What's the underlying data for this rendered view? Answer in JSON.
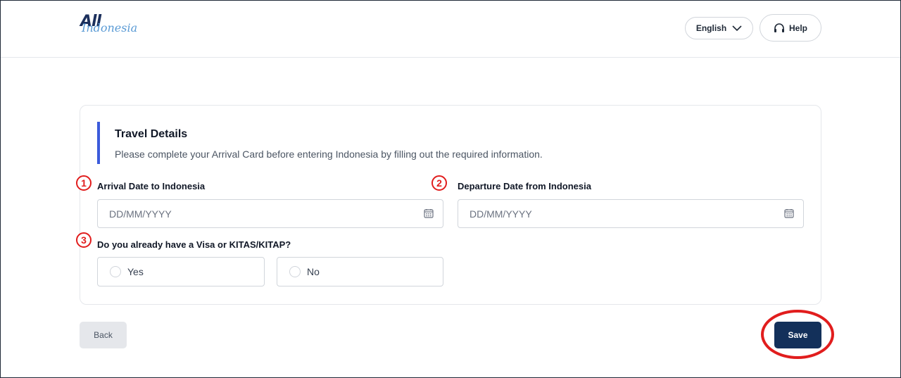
{
  "header": {
    "logo_main": "All",
    "logo_sub": "Indonesia",
    "language_label": "English",
    "help_label": "Help"
  },
  "form": {
    "title": "Travel Details",
    "subtitle": "Please complete your Arrival Card before entering Indonesia by filling out the required information.",
    "arrival": {
      "marker": "1",
      "label": "Arrival Date to Indonesia",
      "placeholder": "DD/MM/YYYY",
      "value": ""
    },
    "departure": {
      "marker": "2",
      "label": "Departure Date from Indonesia",
      "placeholder": "DD/MM/YYYY",
      "value": ""
    },
    "visa": {
      "marker": "3",
      "label": "Do you already have a Visa or KITAS/KITAP?",
      "options": [
        "Yes",
        "No"
      ],
      "selected": null
    }
  },
  "footer": {
    "back_label": "Back",
    "save_label": "Save"
  },
  "colors": {
    "accent_bar": "#3b5bdb",
    "save_button": "#13305a",
    "annotation_red": "#e11d1d"
  },
  "icons": [
    "chevron-down-icon",
    "headset-icon",
    "calendar-icon"
  ]
}
